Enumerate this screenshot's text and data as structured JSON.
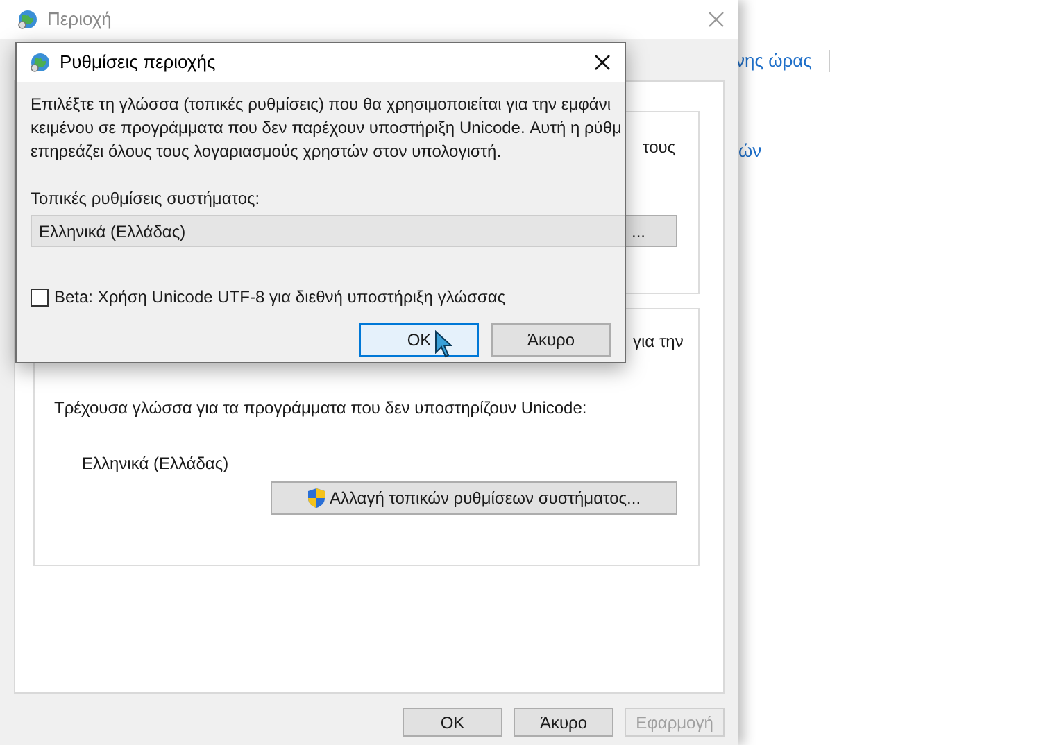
{
  "background_page": {
    "links": [
      "νης ώρας",
      "ών"
    ]
  },
  "window": {
    "title": "Περιοχή",
    "group_1": {
      "text_fragment": "τους",
      "button_fragment": "..."
    },
    "group_2": {
      "text_fragment": "για την",
      "label": "Τρέχουσα γλώσσα για τα προγράμματα που δεν υποστηρίζουν Unicode:",
      "current_value": "Ελληνικά (Ελλάδας)",
      "change_button": "Αλλαγή τοπικών ρυθμίσεων συστήματος..."
    },
    "buttons": [
      {
        "label": "OK",
        "disabled": false
      },
      {
        "label": "Άκυρο",
        "disabled": false
      },
      {
        "label": "Εφαρμογή",
        "disabled": true
      }
    ]
  },
  "dialog": {
    "title": "Ρυθμίσεις περιοχής",
    "description_lines": [
      "Επιλέξτε τη γλώσσα (τοπικές ρυθμίσεις) που θα χρησιμοποιείται για την εμφάνι",
      "κειμένου σε προγράμματα που δεν παρέχουν υποστήριξη Unicode. Αυτή η ρύθμ",
      "επηρεάζει όλους τους λογαριασμούς χρηστών στον υπολογιστή."
    ],
    "locale_label": "Τοπικές ρυθμίσεις συστήματος:",
    "locale_value": "Ελληνικά (Ελλάδας)",
    "beta_checkbox": {
      "label": "Beta: Χρήση Unicode UTF-8 για διεθνή υποστήριξη γλώσσας",
      "checked": false
    },
    "buttons": [
      {
        "label": "OK",
        "focused": true
      },
      {
        "label": "Άκυρο",
        "focused": false
      }
    ]
  }
}
